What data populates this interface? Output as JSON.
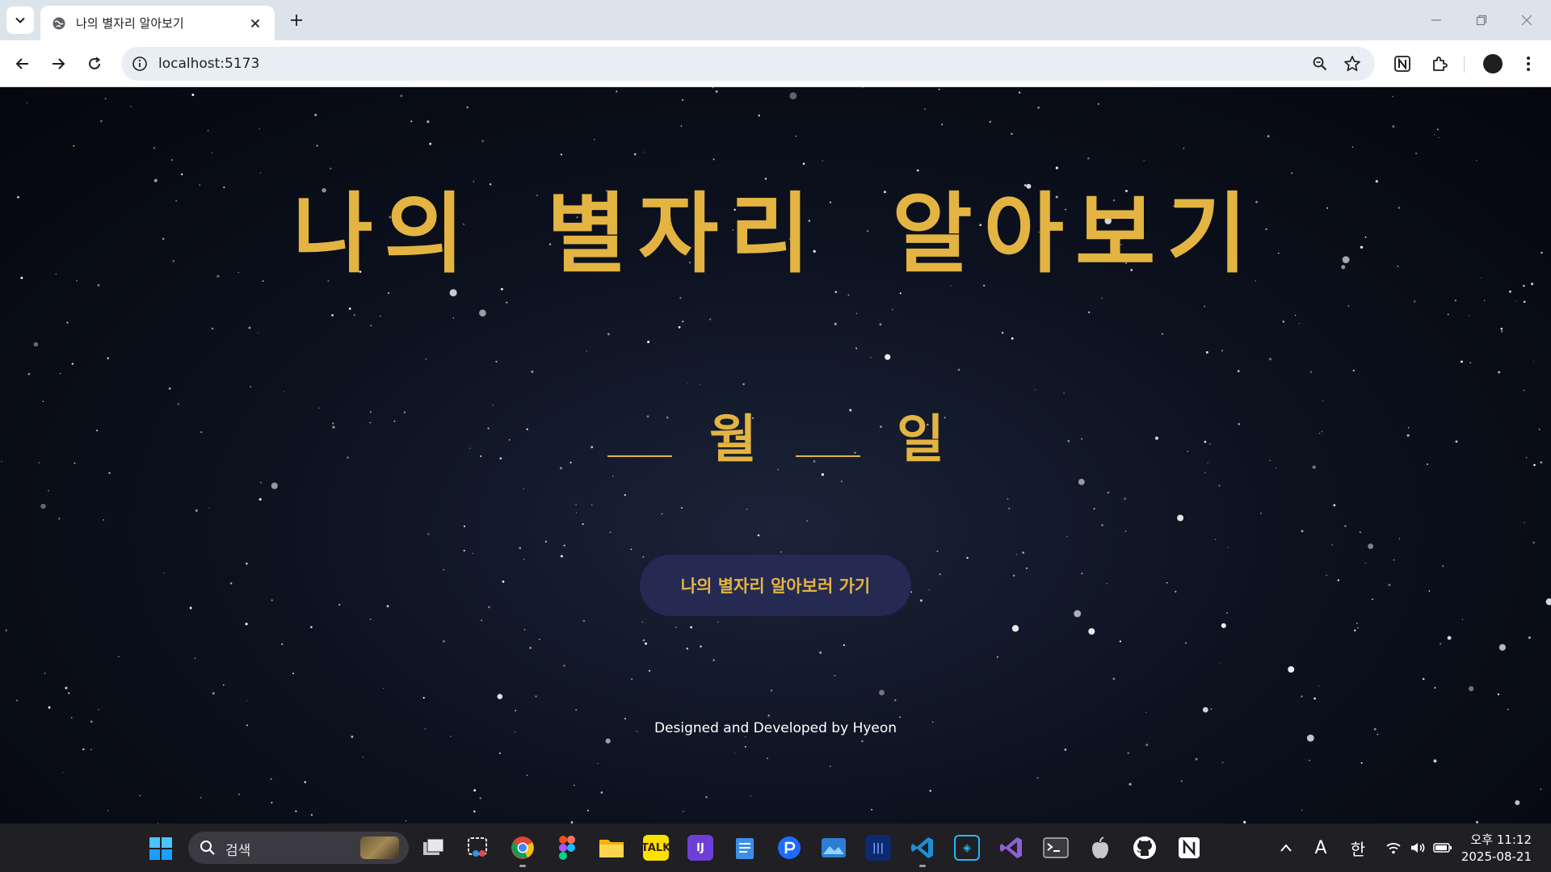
{
  "browser": {
    "tab_title": "나의 별자리 알아보기",
    "url": "localhost:5173"
  },
  "page": {
    "title": "나의 별자리 알아보기",
    "month_unit": "월",
    "day_unit": "일",
    "month_value": "",
    "day_value": "",
    "cta_label": "나의 별자리 알아보러 가기",
    "credit": "Designed and Developed by Hyeon"
  },
  "taskbar": {
    "search_label": "검색",
    "tray_ime_1": "A",
    "tray_ime_2": "한",
    "time": "오후 11:12",
    "date": "2025-08-21"
  },
  "colors": {
    "accent_gold": "#e3b442",
    "button_bg": "#242a52",
    "page_bg": "#0b0f19"
  }
}
